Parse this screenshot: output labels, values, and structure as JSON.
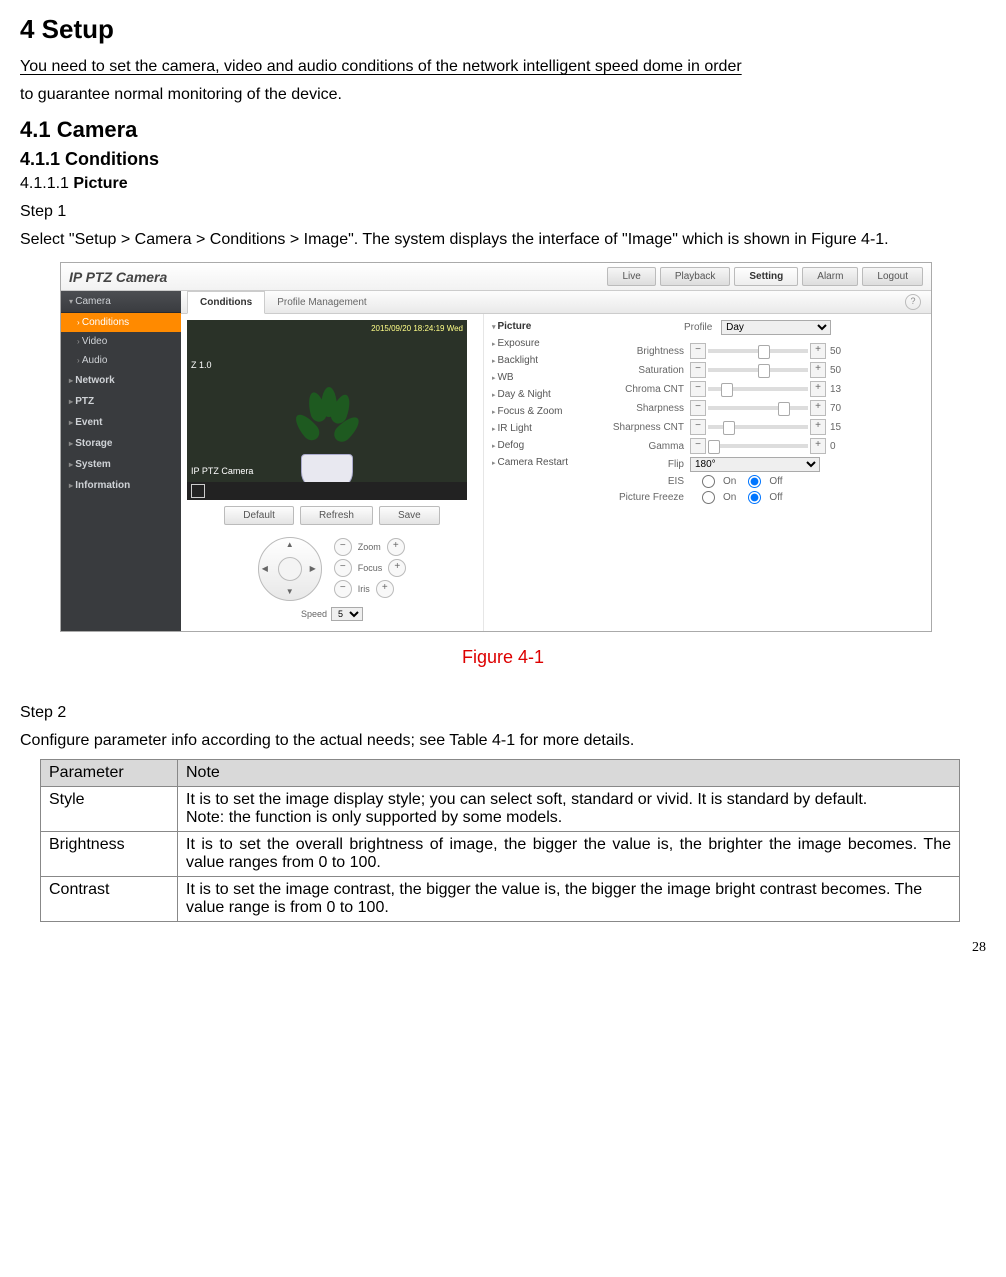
{
  "doc": {
    "h1": "4  Setup",
    "intro1": "You need to set the camera, video and audio conditions of the network intelligent speed dome in order",
    "intro2": "to guarantee normal monitoring of the device.",
    "h2": "4.1  Camera",
    "h3": "4.1.1  Conditions",
    "h4_num": "4.1.1.1 ",
    "h4_bold": "Picture",
    "step1": "Step 1",
    "step1_text": "Select \"Setup > Camera > Conditions > Image\". The system displays the interface of \"Image\" which is shown in Figure 4-1.",
    "figcap": "Figure 4-1",
    "step2": "Step 2",
    "step2_text": "Configure parameter info according to the actual needs; see Table 4-1 for more details.",
    "page_num": "28"
  },
  "table": {
    "h_param": "Parameter",
    "h_note": "Note",
    "rows": [
      {
        "p": "Style",
        "n": "It is to set the image display style; you can select soft, standard or vivid. It is standard by default.\nNote: the function is only supported by some models."
      },
      {
        "p": "Brightness",
        "n": "It is to set the overall brightness of image, the bigger the value is, the brighter the image becomes. The value ranges from 0 to 100."
      },
      {
        "p": "Contrast",
        "n": "It is to set the image contrast, the bigger the value is, the bigger the image bright contrast becomes. The value range is from 0 to 100."
      }
    ]
  },
  "ui": {
    "logo": "IP PTZ Camera",
    "nav": [
      "Live",
      "Playback",
      "Setting",
      "Alarm",
      "Logout"
    ],
    "nav_active_idx": 2,
    "sidebar": {
      "head": "Camera",
      "items": [
        "Conditions",
        "Video",
        "Audio"
      ],
      "active_idx": 0,
      "groups": [
        "Network",
        "PTZ",
        "Event",
        "Storage",
        "System",
        "Information"
      ]
    },
    "tabs": [
      "Conditions",
      "Profile Management"
    ],
    "tabs_active_idx": 0,
    "help_icon": "?",
    "preview": {
      "timestamp": "2015/09/20 18:24:19 Wed",
      "zoom": "Z 1.0",
      "label": "IP PTZ Camera"
    },
    "buttons": [
      "Default",
      "Refresh",
      "Save"
    ],
    "ptz": {
      "zoom_label": "Zoom",
      "focus_label": "Focus",
      "iris_label": "Iris",
      "minus": "−",
      "plus": "+",
      "speed_label": "Speed",
      "speed_value": "5"
    },
    "midcol": [
      "Picture",
      "Exposure",
      "Backlight",
      "WB",
      "Day & Night",
      "Focus & Zoom",
      "IR Light",
      "Defog",
      "Camera Restart"
    ],
    "midcol_active_idx": 0,
    "right": {
      "profile_label": "Profile",
      "profile_value": "Day",
      "sliders": [
        {
          "label": "Brightness",
          "val": "50",
          "pct": 50
        },
        {
          "label": "Saturation",
          "val": "50",
          "pct": 50
        },
        {
          "label": "Chroma CNT",
          "val": "13",
          "pct": 13
        },
        {
          "label": "Sharpness",
          "val": "70",
          "pct": 70
        },
        {
          "label": "Sharpness CNT",
          "val": "15",
          "pct": 15
        },
        {
          "label": "Gamma",
          "val": "0",
          "pct": 0
        }
      ],
      "flip_label": "Flip",
      "flip_value": "180°",
      "eis_label": "EIS",
      "freeze_label": "Picture Freeze",
      "on": "On",
      "off": "Off"
    }
  }
}
